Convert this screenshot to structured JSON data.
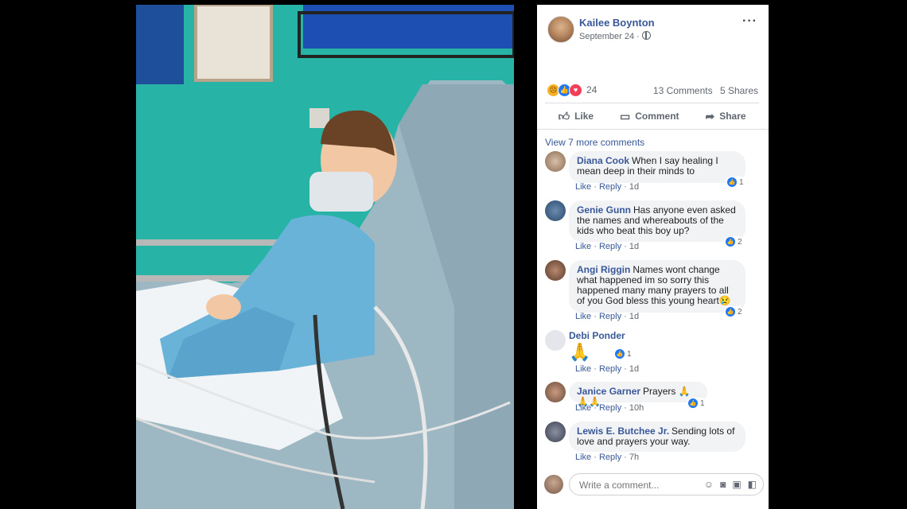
{
  "post": {
    "author": "Kailee Boynton",
    "date": "September 24 ·",
    "reaction_count": "24",
    "comments_count": "13 Comments",
    "shares_count": "5 Shares",
    "reactions": [
      "sad",
      "like",
      "love"
    ]
  },
  "actions": {
    "like": "Like",
    "comment": "Comment",
    "share": "Share"
  },
  "view_more": "View 7 more comments",
  "comments": [
    {
      "name": "Diana Cook",
      "text": "When I say healing I mean deep in their minds to",
      "likes": "1",
      "like": "Like",
      "reply": "Reply",
      "time": "1d"
    },
    {
      "name": "Genie Gunn",
      "text": "Has anyone even asked the names and whereabouts of the kids who beat this boy up?",
      "likes": "2",
      "like": "Like",
      "reply": "Reply",
      "time": "1d"
    },
    {
      "name": "Angi Riggin",
      "text": "Names wont change what happened im so sorry this happened many many prayers to all of you God bless this young heart😢",
      "likes": "2",
      "like": "Like",
      "reply": "Reply",
      "time": "1d"
    },
    {
      "name": "Debi Ponder",
      "text": "🙏",
      "likes": "1",
      "like": "Like",
      "reply": "Reply",
      "time": "1d"
    },
    {
      "name": "Janice Garner",
      "text": "Prayers 🙏🙏🙏",
      "likes": "1",
      "like": "Like",
      "reply": "Reply",
      "time": "10h"
    },
    {
      "name": "Lewis E. Butchee Jr.",
      "text": "Sending lots of love and prayers your way.",
      "like": "Like",
      "reply": "Reply",
      "time": "7h"
    }
  ],
  "compose": {
    "placeholder": "Write a comment..."
  },
  "colors": {
    "link": "#385898",
    "like_blue": "#2078f4",
    "bubble": "#f2f3f5",
    "wall_teal": "#27b3a6"
  },
  "icons": [
    "more-options-icon",
    "globe-icon",
    "like-icon",
    "comment-icon",
    "share-icon",
    "emoji-icon",
    "camera-icon",
    "gif-icon",
    "sticker-icon"
  ]
}
